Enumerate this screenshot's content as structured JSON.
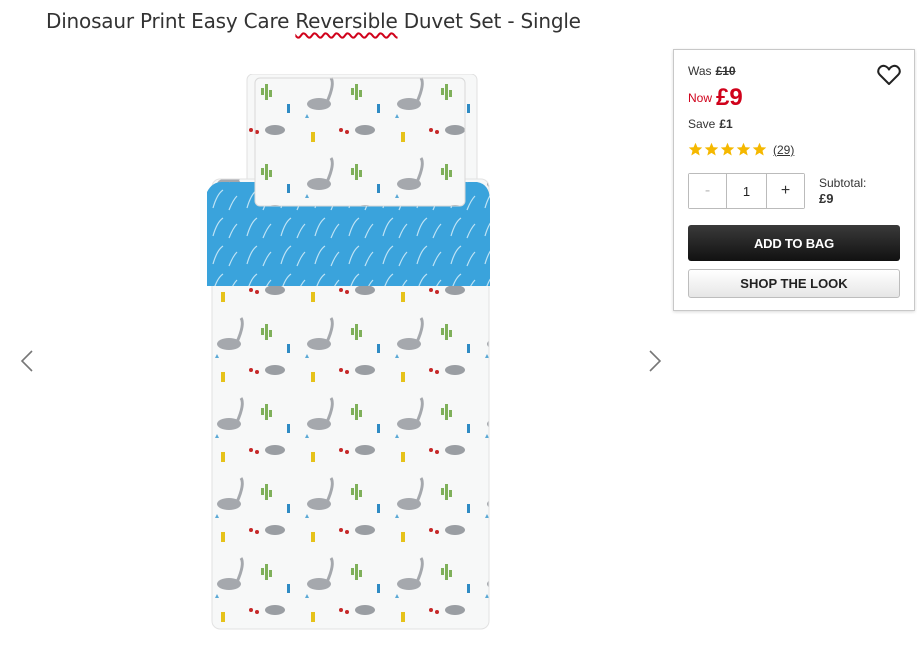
{
  "product": {
    "title_before": "Dinosaur Print Easy Care ",
    "title_misspelled": "Reversible",
    "title_after": " Duvet Set - Single"
  },
  "pricing": {
    "was_label": "Was",
    "was_price": "£10",
    "now_label": "Now",
    "now_price": "£9",
    "save_label": "Save",
    "save_amount": "£1"
  },
  "rating": {
    "stars": 5,
    "reviews_count": "(29)"
  },
  "quantity": {
    "minus": "-",
    "value": "1",
    "plus": "+"
  },
  "subtotal": {
    "label": "Subtotal:",
    "value": "£9"
  },
  "buttons": {
    "add_to_bag": "ADD TO BAG",
    "shop_the_look": "SHOP THE LOOK"
  },
  "colors": {
    "price_red": "#d0021b",
    "star_gold": "#f5b800",
    "duvet_blue": "#3aa3dc"
  },
  "icons": [
    "chevron-left-icon",
    "chevron-right-icon",
    "heart-icon",
    "star-icon"
  ]
}
